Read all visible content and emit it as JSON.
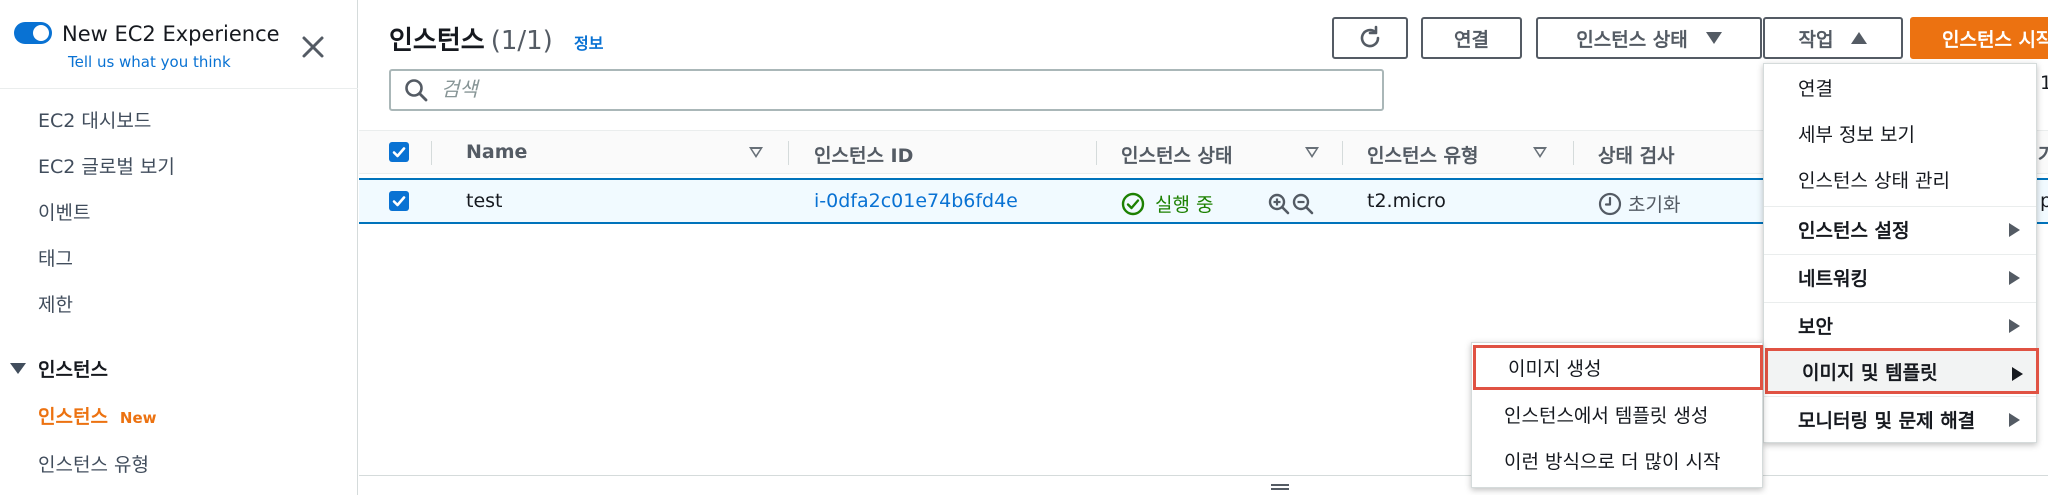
{
  "sidebar": {
    "toggle_title": "New EC2 Experience",
    "toggle_link": "Tell us what you think",
    "items": [
      {
        "label": "EC2 대시보드"
      },
      {
        "label": "EC2 글로벌 보기"
      },
      {
        "label": "이벤트"
      },
      {
        "label": "태그"
      },
      {
        "label": "제한"
      }
    ],
    "section": "인스턴스",
    "active_item": "인스턴스",
    "active_badge": "New",
    "after_item": "인스턴스 유형"
  },
  "header": {
    "title": "인스턴스",
    "count": "(1/1)",
    "info": "정보",
    "connect_label": "연결",
    "state_label": "인스턴스 상태",
    "actions_label": "작업",
    "launch_label": "인스턴스 시작"
  },
  "search": {
    "placeholder": "검색"
  },
  "table": {
    "columns": [
      "Name",
      "인스턴스 ID",
      "인스턴스 상태",
      "인스턴스 유형",
      "상태 검사"
    ],
    "rows": [
      {
        "name": "test",
        "instance_id": "i-0dfa2c01e74b6fd4e",
        "state": "실행 중",
        "type": "t2.micro",
        "status_check": "초기화"
      }
    ]
  },
  "actions_menu": {
    "items": [
      {
        "label": "연결"
      },
      {
        "label": "세부 정보 보기"
      },
      {
        "label": "인스턴스 상태 관리"
      },
      {
        "label": "인스턴스 설정"
      },
      {
        "label": "네트워킹"
      },
      {
        "label": "보안"
      },
      {
        "label": "이미지 및 템플릿"
      },
      {
        "label": "모니터링 및 문제 해결"
      }
    ]
  },
  "submenu": {
    "items": [
      {
        "label": "이미지 생성"
      },
      {
        "label": "인스턴스에서 템플릿 생성"
      },
      {
        "label": "이런 방식으로 더 많이 시작"
      }
    ]
  },
  "edge": {
    "top_right_fragment": "1",
    "header_fragment": "가",
    "row_fragment": "p"
  },
  "colors": {
    "accent": "#0972d3",
    "orange": "#ec7211",
    "running": "#1d8102",
    "highlight_border": "#e05243"
  }
}
